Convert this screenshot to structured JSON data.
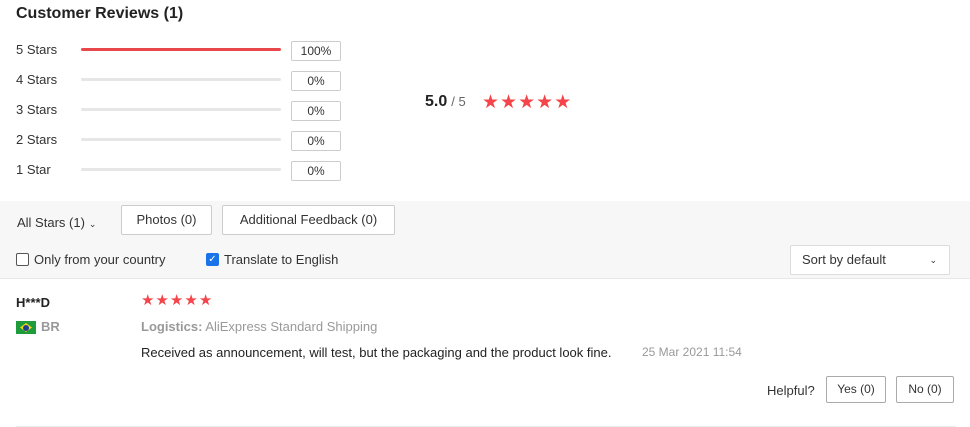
{
  "title": "Customer Reviews (1)",
  "distribution": [
    {
      "label": "5 Stars",
      "percent": 100,
      "percent_text": "100%"
    },
    {
      "label": "4 Stars",
      "percent": 0,
      "percent_text": "0%"
    },
    {
      "label": "3 Stars",
      "percent": 0,
      "percent_text": "0%"
    },
    {
      "label": "2 Stars",
      "percent": 0,
      "percent_text": "0%"
    },
    {
      "label": "1 Star",
      "percent": 0,
      "percent_text": "0%"
    }
  ],
  "average": {
    "value": "5.0",
    "max": "/ 5",
    "stars": 5
  },
  "colors": {
    "accent": "#e8474c",
    "star": "#f5444a",
    "checkbox": "#1a73e8"
  },
  "filters": {
    "all_stars": "All Stars (1)",
    "photos": "Photos (0)",
    "additional": "Additional Feedback (0)",
    "only_country": "Only from your country",
    "only_country_checked": false,
    "translate": "Translate to English",
    "translate_checked": true,
    "sort": "Sort by default"
  },
  "review": {
    "name": "H***D",
    "country": "BR",
    "flag_icon": "brazil-flag-icon",
    "stars": 5,
    "logistics_label": "Logistics:",
    "logistics_value": "AliExpress Standard Shipping",
    "text": "Received as announcement, will test, but the packaging and the product look fine.",
    "date": "25 Mar 2021 11:54",
    "helpful_label": "Helpful?",
    "yes": "Yes (0)",
    "no": "No (0)"
  }
}
